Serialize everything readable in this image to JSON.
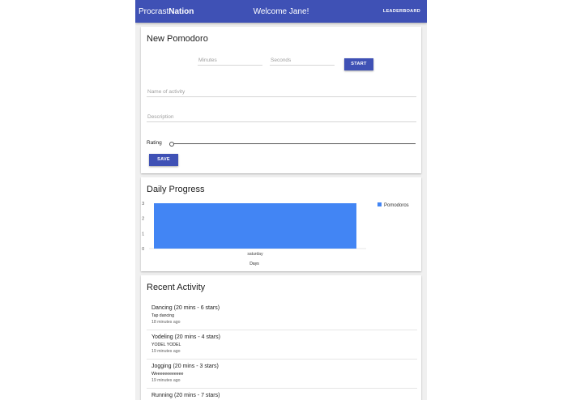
{
  "topbar": {
    "brand_light": "Procrast",
    "brand_bold": "Nation",
    "welcome": "Welcome Jane!",
    "leaderboard": "LEADERBOARD"
  },
  "pomodoro": {
    "title": "New Pomodoro",
    "minutes_placeholder": "Minutes",
    "seconds_placeholder": "Seconds",
    "start_label": "START",
    "activity_placeholder": "Name of activity",
    "description_placeholder": "Description",
    "rating_label": "Rating",
    "rating_value": 0,
    "save_label": "SAVE"
  },
  "progress": {
    "title": "Daily Progress"
  },
  "chart_data": {
    "type": "bar",
    "categories": [
      "saturday"
    ],
    "series": [
      {
        "name": "Pomodoros",
        "values": [
          3
        ]
      }
    ],
    "xlabel": "Days",
    "ylabel": "",
    "ylim": [
      0,
      3
    ],
    "yticks": [
      0,
      1,
      2,
      3
    ],
    "legend": "right",
    "color": "#4285f4"
  },
  "recent": {
    "title": "Recent Activity",
    "items": [
      {
        "title": "Dancing (20 mins - 6 stars)",
        "desc": "Tap dancing",
        "time": "18 minutes ago"
      },
      {
        "title": "Yodeling (20 mins - 4 stars)",
        "desc": "YODEL YODEL",
        "time": "19 minutes ago"
      },
      {
        "title": "Jogging (20 mins - 3 stars)",
        "desc": "Weeeeeeeeeeee",
        "time": "19 minutes ago"
      },
      {
        "title": "Running (20 mins - 7 stars)",
        "desc": "",
        "time": ""
      }
    ]
  }
}
